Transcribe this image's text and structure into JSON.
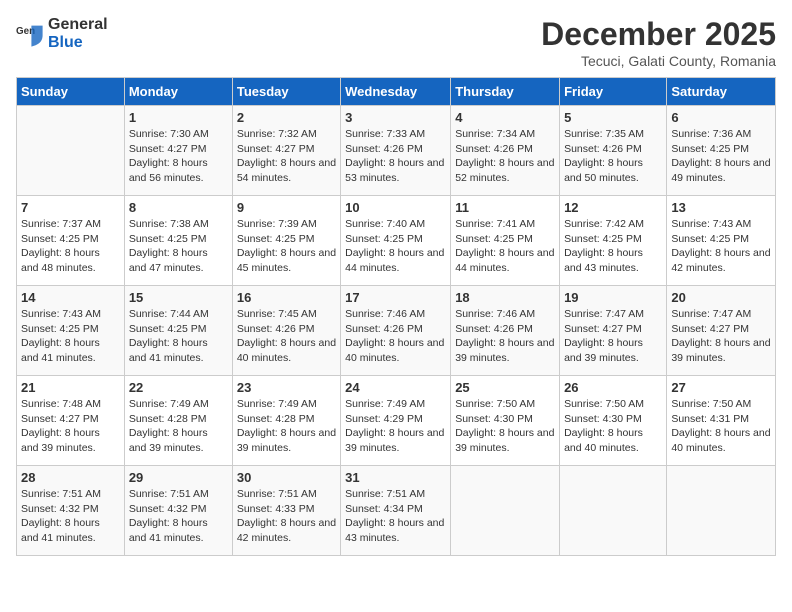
{
  "logo": {
    "general": "General",
    "blue": "Blue"
  },
  "title": "December 2025",
  "subtitle": "Tecuci, Galati County, Romania",
  "days_header": [
    "Sunday",
    "Monday",
    "Tuesday",
    "Wednesday",
    "Thursday",
    "Friday",
    "Saturday"
  ],
  "weeks": [
    [
      {
        "num": "",
        "sunrise": "",
        "sunset": "",
        "daylight": ""
      },
      {
        "num": "1",
        "sunrise": "Sunrise: 7:30 AM",
        "sunset": "Sunset: 4:27 PM",
        "daylight": "Daylight: 8 hours and 56 minutes."
      },
      {
        "num": "2",
        "sunrise": "Sunrise: 7:32 AM",
        "sunset": "Sunset: 4:27 PM",
        "daylight": "Daylight: 8 hours and 54 minutes."
      },
      {
        "num": "3",
        "sunrise": "Sunrise: 7:33 AM",
        "sunset": "Sunset: 4:26 PM",
        "daylight": "Daylight: 8 hours and 53 minutes."
      },
      {
        "num": "4",
        "sunrise": "Sunrise: 7:34 AM",
        "sunset": "Sunset: 4:26 PM",
        "daylight": "Daylight: 8 hours and 52 minutes."
      },
      {
        "num": "5",
        "sunrise": "Sunrise: 7:35 AM",
        "sunset": "Sunset: 4:26 PM",
        "daylight": "Daylight: 8 hours and 50 minutes."
      },
      {
        "num": "6",
        "sunrise": "Sunrise: 7:36 AM",
        "sunset": "Sunset: 4:25 PM",
        "daylight": "Daylight: 8 hours and 49 minutes."
      }
    ],
    [
      {
        "num": "7",
        "sunrise": "Sunrise: 7:37 AM",
        "sunset": "Sunset: 4:25 PM",
        "daylight": "Daylight: 8 hours and 48 minutes."
      },
      {
        "num": "8",
        "sunrise": "Sunrise: 7:38 AM",
        "sunset": "Sunset: 4:25 PM",
        "daylight": "Daylight: 8 hours and 47 minutes."
      },
      {
        "num": "9",
        "sunrise": "Sunrise: 7:39 AM",
        "sunset": "Sunset: 4:25 PM",
        "daylight": "Daylight: 8 hours and 45 minutes."
      },
      {
        "num": "10",
        "sunrise": "Sunrise: 7:40 AM",
        "sunset": "Sunset: 4:25 PM",
        "daylight": "Daylight: 8 hours and 44 minutes."
      },
      {
        "num": "11",
        "sunrise": "Sunrise: 7:41 AM",
        "sunset": "Sunset: 4:25 PM",
        "daylight": "Daylight: 8 hours and 44 minutes."
      },
      {
        "num": "12",
        "sunrise": "Sunrise: 7:42 AM",
        "sunset": "Sunset: 4:25 PM",
        "daylight": "Daylight: 8 hours and 43 minutes."
      },
      {
        "num": "13",
        "sunrise": "Sunrise: 7:43 AM",
        "sunset": "Sunset: 4:25 PM",
        "daylight": "Daylight: 8 hours and 42 minutes."
      }
    ],
    [
      {
        "num": "14",
        "sunrise": "Sunrise: 7:43 AM",
        "sunset": "Sunset: 4:25 PM",
        "daylight": "Daylight: 8 hours and 41 minutes."
      },
      {
        "num": "15",
        "sunrise": "Sunrise: 7:44 AM",
        "sunset": "Sunset: 4:25 PM",
        "daylight": "Daylight: 8 hours and 41 minutes."
      },
      {
        "num": "16",
        "sunrise": "Sunrise: 7:45 AM",
        "sunset": "Sunset: 4:26 PM",
        "daylight": "Daylight: 8 hours and 40 minutes."
      },
      {
        "num": "17",
        "sunrise": "Sunrise: 7:46 AM",
        "sunset": "Sunset: 4:26 PM",
        "daylight": "Daylight: 8 hours and 40 minutes."
      },
      {
        "num": "18",
        "sunrise": "Sunrise: 7:46 AM",
        "sunset": "Sunset: 4:26 PM",
        "daylight": "Daylight: 8 hours and 39 minutes."
      },
      {
        "num": "19",
        "sunrise": "Sunrise: 7:47 AM",
        "sunset": "Sunset: 4:27 PM",
        "daylight": "Daylight: 8 hours and 39 minutes."
      },
      {
        "num": "20",
        "sunrise": "Sunrise: 7:47 AM",
        "sunset": "Sunset: 4:27 PM",
        "daylight": "Daylight: 8 hours and 39 minutes."
      }
    ],
    [
      {
        "num": "21",
        "sunrise": "Sunrise: 7:48 AM",
        "sunset": "Sunset: 4:27 PM",
        "daylight": "Daylight: 8 hours and 39 minutes."
      },
      {
        "num": "22",
        "sunrise": "Sunrise: 7:49 AM",
        "sunset": "Sunset: 4:28 PM",
        "daylight": "Daylight: 8 hours and 39 minutes."
      },
      {
        "num": "23",
        "sunrise": "Sunrise: 7:49 AM",
        "sunset": "Sunset: 4:28 PM",
        "daylight": "Daylight: 8 hours and 39 minutes."
      },
      {
        "num": "24",
        "sunrise": "Sunrise: 7:49 AM",
        "sunset": "Sunset: 4:29 PM",
        "daylight": "Daylight: 8 hours and 39 minutes."
      },
      {
        "num": "25",
        "sunrise": "Sunrise: 7:50 AM",
        "sunset": "Sunset: 4:30 PM",
        "daylight": "Daylight: 8 hours and 39 minutes."
      },
      {
        "num": "26",
        "sunrise": "Sunrise: 7:50 AM",
        "sunset": "Sunset: 4:30 PM",
        "daylight": "Daylight: 8 hours and 40 minutes."
      },
      {
        "num": "27",
        "sunrise": "Sunrise: 7:50 AM",
        "sunset": "Sunset: 4:31 PM",
        "daylight": "Daylight: 8 hours and 40 minutes."
      }
    ],
    [
      {
        "num": "28",
        "sunrise": "Sunrise: 7:51 AM",
        "sunset": "Sunset: 4:32 PM",
        "daylight": "Daylight: 8 hours and 41 minutes."
      },
      {
        "num": "29",
        "sunrise": "Sunrise: 7:51 AM",
        "sunset": "Sunset: 4:32 PM",
        "daylight": "Daylight: 8 hours and 41 minutes."
      },
      {
        "num": "30",
        "sunrise": "Sunrise: 7:51 AM",
        "sunset": "Sunset: 4:33 PM",
        "daylight": "Daylight: 8 hours and 42 minutes."
      },
      {
        "num": "31",
        "sunrise": "Sunrise: 7:51 AM",
        "sunset": "Sunset: 4:34 PM",
        "daylight": "Daylight: 8 hours and 43 minutes."
      },
      {
        "num": "",
        "sunrise": "",
        "sunset": "",
        "daylight": ""
      },
      {
        "num": "",
        "sunrise": "",
        "sunset": "",
        "daylight": ""
      },
      {
        "num": "",
        "sunrise": "",
        "sunset": "",
        "daylight": ""
      }
    ]
  ]
}
